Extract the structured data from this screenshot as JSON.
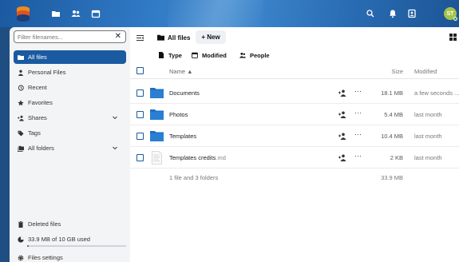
{
  "header": {
    "avatar_initials": "ST",
    "accent": "#1a5aa1"
  },
  "sidebar": {
    "filter_placeholder": "Filter filenames...",
    "items": [
      {
        "label": "All files",
        "icon": "folder-icon",
        "active": true
      },
      {
        "label": "Personal Files",
        "icon": "user-icon"
      },
      {
        "label": "Recent",
        "icon": "history-icon"
      },
      {
        "label": "Favorites",
        "icon": "star-icon"
      },
      {
        "label": "Shares",
        "icon": "share-icon",
        "expandable": true
      },
      {
        "label": "Tags",
        "icon": "tag-icon"
      },
      {
        "label": "All folders",
        "icon": "folder-multiple-icon",
        "expandable": true
      }
    ],
    "deleted_files": "Deleted files",
    "quota_text": "33.9 MB of 10 GB used",
    "quota_fraction": 0.0034,
    "settings": "Files settings"
  },
  "main": {
    "breadcrumb": "All files",
    "new_label": "+ New",
    "filters": [
      {
        "label": "Type",
        "icon": "file-icon"
      },
      {
        "label": "Modified",
        "icon": "calendar-icon"
      },
      {
        "label": "People",
        "icon": "people-icon"
      }
    ],
    "columns": {
      "name": "Name",
      "size": "Size",
      "modified": "Modified"
    },
    "rows": [
      {
        "name": "Documents",
        "ext": "",
        "type": "folder",
        "size": "18.1 MB",
        "modified": "a few seconds ..."
      },
      {
        "name": "Photos",
        "ext": "",
        "type": "folder",
        "size": "5.4 MB",
        "modified": "last month"
      },
      {
        "name": "Templates",
        "ext": "",
        "type": "folder",
        "size": "10.4 MB",
        "modified": "last month"
      },
      {
        "name": "Templates credits",
        "ext": ".md",
        "type": "file",
        "size": "2 KB",
        "modified": "last month"
      }
    ],
    "more_glyph": "···",
    "summary": "1 file and 3 folders",
    "summary_size": "33.9 MB"
  }
}
